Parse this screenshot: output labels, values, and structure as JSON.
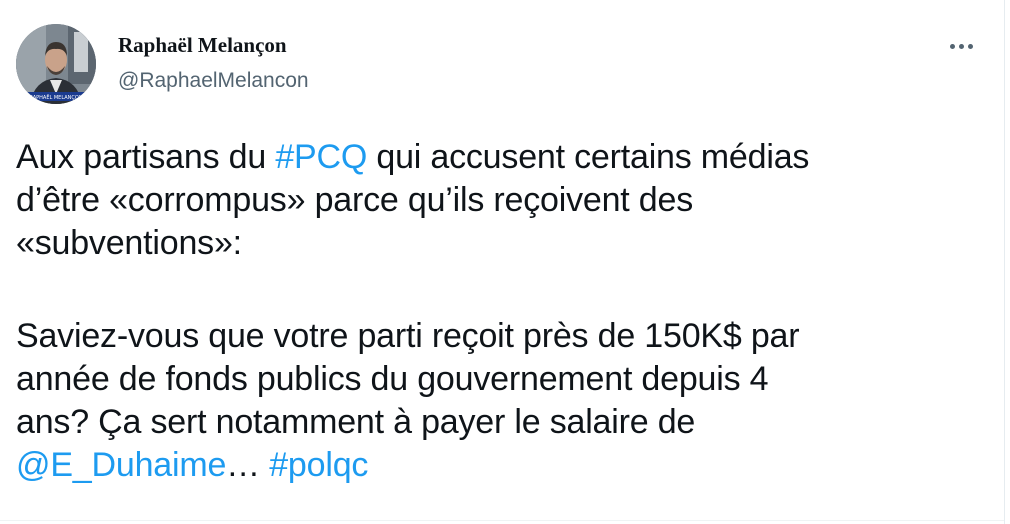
{
  "tweet": {
    "author": {
      "display_name": "Raphaël Melançon",
      "handle": "@RaphaelMelancon",
      "avatar_caption": "RAPHAËL MELANÇON"
    },
    "more_icon": "more-horizontal-icon",
    "body": {
      "line1_pre": "Aux partisans du ",
      "line1_hashtag": "#PCQ",
      "line1_post": " qui accusent certains médias",
      "line2": "d’être «corrompus» parce qu’ils reçoivent des",
      "line3": "«subventions»:",
      "line4": "Saviez-vous que votre parti reçoit près de 150K$ par",
      "line5": "année de fonds publics du gouvernement depuis 4",
      "line6": "ans? Ça sert notamment à payer le salaire de",
      "mention": "@E_Duhaime",
      "ellipsis": "… ",
      "hashtag2": "#polqc"
    }
  },
  "colors": {
    "link": "#1d9bf0",
    "text": "#0f1419",
    "secondary": "#536471"
  }
}
